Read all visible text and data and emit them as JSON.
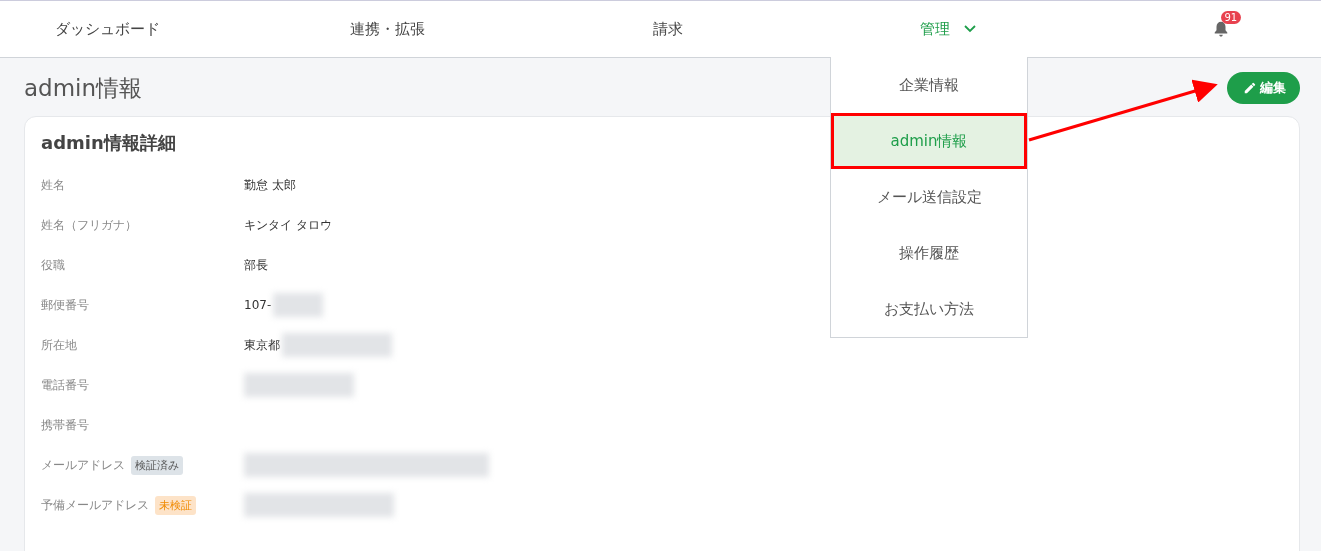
{
  "nav": {
    "items": [
      {
        "label": "ダッシュボード",
        "selected": false,
        "kind": "link"
      },
      {
        "label": "連携・拡張",
        "selected": false,
        "kind": "link"
      },
      {
        "label": "請求",
        "selected": false,
        "kind": "link"
      },
      {
        "label": "管理",
        "selected": true,
        "kind": "dropdown"
      }
    ],
    "notifications": {
      "count": "91"
    }
  },
  "menu": {
    "items": [
      {
        "label": "企業情報",
        "selected": false,
        "highlighted": false
      },
      {
        "label": "admin情報",
        "selected": true,
        "highlighted": true
      },
      {
        "label": "メール送信設定",
        "selected": false,
        "highlighted": false
      },
      {
        "label": "操作履歴",
        "selected": false,
        "highlighted": false
      },
      {
        "label": "お支払い方法",
        "selected": false,
        "highlighted": false
      }
    ]
  },
  "page": {
    "title": "admin情報",
    "edit_button": "編集"
  },
  "card": {
    "title": "admin情報詳細",
    "rows": [
      {
        "label": "姓名",
        "value": "勤怠 太郎",
        "blurred": false
      },
      {
        "label": "姓名（フリガナ）",
        "value": "キンタイ タロウ",
        "blurred": false
      },
      {
        "label": "役職",
        "value": "部長",
        "blurred": false
      },
      {
        "label": "郵便番号",
        "value": "107-",
        "blurred": true
      },
      {
        "label": "所在地",
        "value": "東京都",
        "blurred": true
      },
      {
        "label": "電話番号",
        "blurred": true
      },
      {
        "label": "携帯番号",
        "blurred": false
      },
      {
        "label": "メールアドレス",
        "badge": {
          "text": "検証済み",
          "kind": "verified"
        },
        "blurred": true
      },
      {
        "label": "予備メールアドレス",
        "badge": {
          "text": "未検証",
          "kind": "unverified"
        },
        "blurred": true
      }
    ]
  }
}
